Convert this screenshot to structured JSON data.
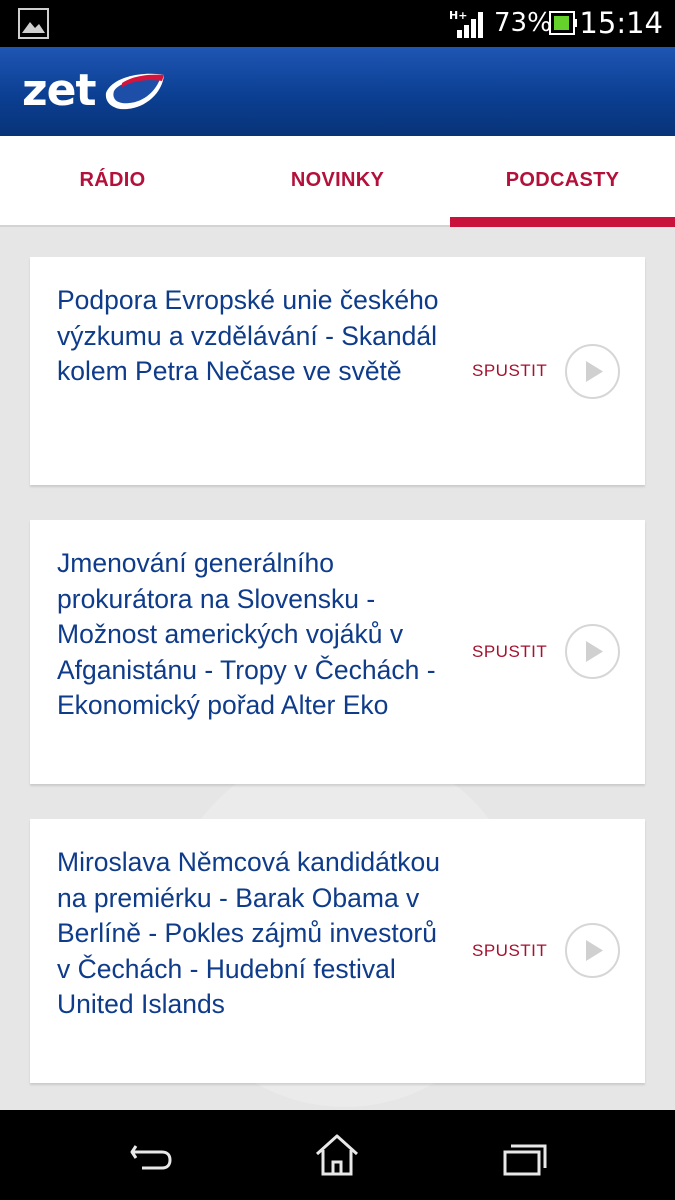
{
  "status_bar": {
    "network": "H+",
    "battery": "73%",
    "time": "15:14"
  },
  "header": {
    "logo_text": "zet"
  },
  "tabs": [
    {
      "label": "RÁDIO",
      "active": false
    },
    {
      "label": "NOVINKY",
      "active": false
    },
    {
      "label": "PODCASTY",
      "active": true
    }
  ],
  "podcasts": [
    {
      "title": "Podpora Evropské unie českého výzkumu a vzdělávání - Skandál kolem Petra Nečase ve světě",
      "action": "SPUSTIT"
    },
    {
      "title": "Jmenování generálního prokurátora na Slovensku - Možnost amerických vojáků v Afganistánu - Tropy v Čechách - Ekonomický pořad Alter Eko",
      "action": "SPUSTIT"
    },
    {
      "title": "Miroslava Němcová kandidátkou na premiérku - Barak Obama v Berlíně - Pokles zájmů investorů v Čechách - Hudební festival United Islands",
      "action": "SPUSTIT"
    }
  ],
  "icons": {
    "gallery": "image-icon",
    "signal": "signal-icon",
    "battery": "battery-icon",
    "play": "play-icon",
    "back": "back-icon",
    "home": "home-icon",
    "recents": "recent-apps-icon"
  },
  "colors": {
    "accent": "#c9133c",
    "title": "#0f3c8a",
    "header": "#0b3f92"
  }
}
